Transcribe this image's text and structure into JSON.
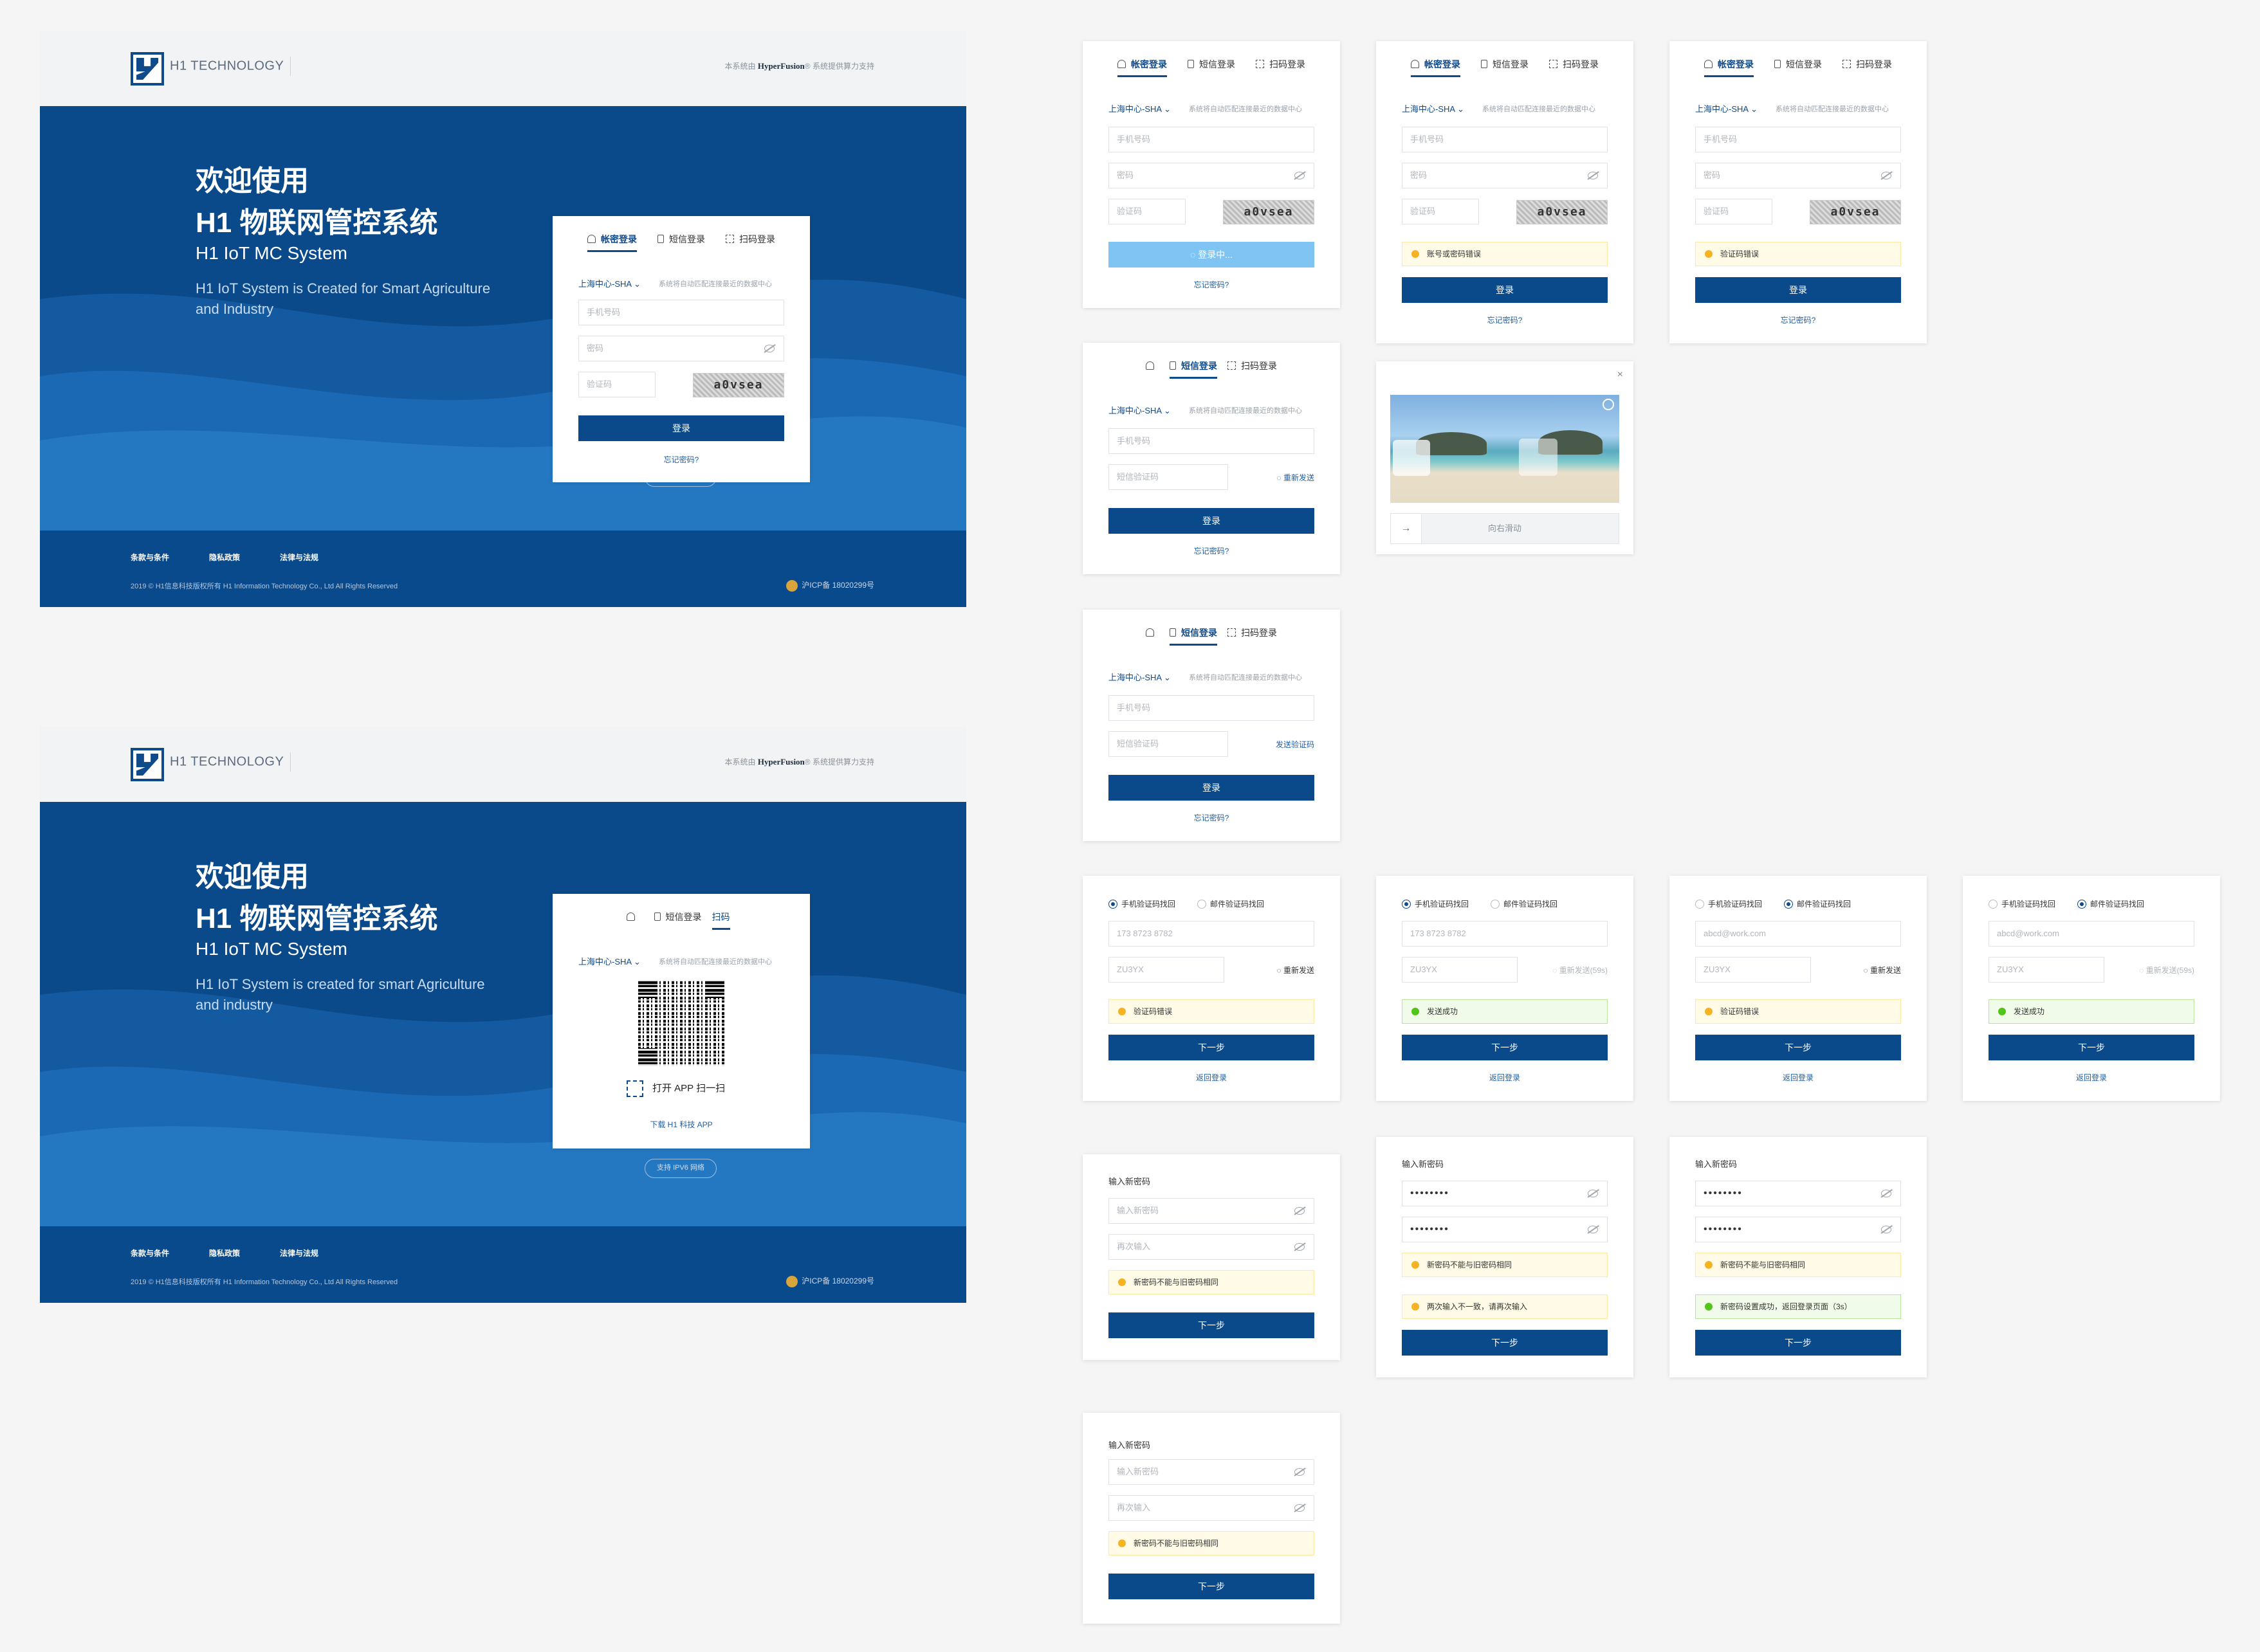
{
  "brand": {
    "name": "H1 TECHNOLOGY",
    "powered_pre": "本系统由",
    "powered_name": "HyperFusion",
    "powered_post": "系统提供算力支持"
  },
  "hero": {
    "welcome": "欢迎使用",
    "title": "H1 物联网管控系统",
    "subtitle": "H1 IoT MC System",
    "desc1": "H1 IoT System is Created for Smart Agriculture and Industry",
    "desc2": "H1 IoT System is created for smart Agriculture and industry",
    "ipv6": "支持 IPV6 网络"
  },
  "footer": {
    "links": [
      "条款与条件",
      "隐私政策",
      "法律与法规"
    ],
    "copyright": "2019 © H1信息科技版权所有 H1 Information Technology Co., Ltd All Rights Reserved",
    "icp": "沪ICP备 18020299号"
  },
  "login": {
    "tab_password": "帐密登录",
    "tab_sms": "短信登录",
    "tab_qr": "扫码登录",
    "tab_qr_short": "扫码",
    "region": "上海中心-SHA ⌄",
    "region_hint": "系统将自动匹配连接最近的数据中心",
    "phone_placeholder": "手机号码",
    "password_placeholder": "密码",
    "captcha_placeholder": "验证码",
    "sms_placeholder": "短信验证码",
    "captcha_text": "a0vsea",
    "login_button": "登录",
    "loading_button": "◌ 登录中...",
    "forgot": "忘记密码?",
    "resend": "◌ 重新发送",
    "send_code": "发送验证码",
    "error_account": "账号或密码错误",
    "error_captcha": "验证码错误",
    "qr_scan": "打开 APP 扫一扫",
    "qr_download": "下载 H1 科技 APP",
    "slider_hint": "向右滑动"
  },
  "recover": {
    "by_phone": "手机验证码找回",
    "by_email": "邮件验证码找回",
    "phone_value": "173 8723 8782",
    "email_value": "abcd@work.com",
    "code_value": "ZU3YX",
    "resend": "◌ 重新发送",
    "resend_wait": "◌ 重新发送(59s)",
    "error_code": "验证码错误",
    "sent_ok": "发送成功",
    "next": "下一步",
    "back": "返回登录"
  },
  "newpwd": {
    "title": "输入新密码",
    "new_placeholder": "输入新密码",
    "again_placeholder": "再次输入",
    "masked": "••••••••",
    "err_same": "新密码不能与旧密码相同",
    "err_mismatch": "两次输入不一致，请再次输入",
    "ok_done": "新密码设置成功，返回登录页面（3s）",
    "next": "下一步"
  }
}
